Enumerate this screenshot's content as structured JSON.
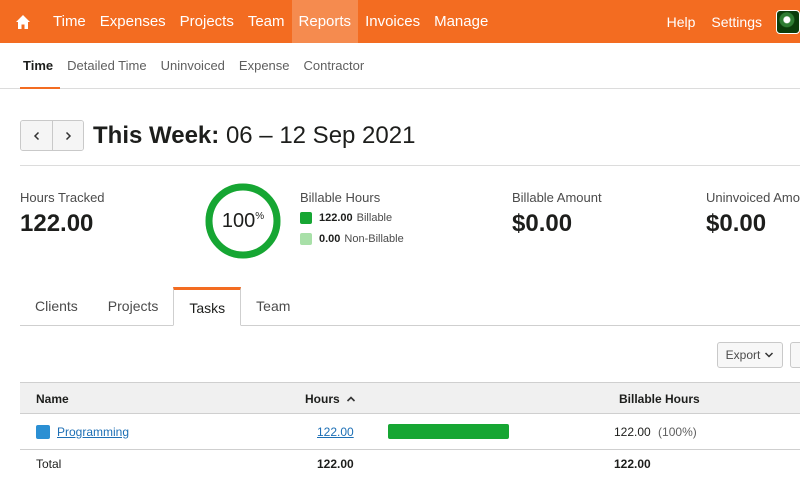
{
  "topnav": {
    "items": [
      {
        "label": "Time"
      },
      {
        "label": "Expenses"
      },
      {
        "label": "Projects"
      },
      {
        "label": "Team"
      },
      {
        "label": "Reports"
      },
      {
        "label": "Invoices"
      },
      {
        "label": "Manage"
      }
    ],
    "active": "Reports",
    "right": [
      {
        "label": "Help"
      },
      {
        "label": "Settings"
      }
    ]
  },
  "subnav": {
    "items": [
      {
        "label": "Time"
      },
      {
        "label": "Detailed Time"
      },
      {
        "label": "Uninvoiced"
      },
      {
        "label": "Expense"
      },
      {
        "label": "Contractor"
      }
    ],
    "active": "Time"
  },
  "period": {
    "bold": "This Week:",
    "range": "06 – 12 Sep 2021"
  },
  "summary": {
    "hours_tracked": {
      "label": "Hours Tracked",
      "value": "122.00"
    },
    "billable_percent": {
      "value": "100",
      "unit": "%",
      "fraction": 1.0
    },
    "billable_hours": {
      "label": "Billable Hours",
      "billable": {
        "value": "122.00",
        "label": "Billable"
      },
      "non_billable": {
        "value": "0.00",
        "label": "Non-Billable"
      }
    },
    "billable_amount": {
      "label": "Billable Amount",
      "value": "$0.00"
    },
    "uninvoiced_amount": {
      "label": "Uninvoiced Amo",
      "value": "$0.00"
    }
  },
  "tabs": [
    {
      "label": "Clients"
    },
    {
      "label": "Projects"
    },
    {
      "label": "Tasks"
    },
    {
      "label": "Team"
    }
  ],
  "active_tab": "Tasks",
  "export_label": "Export",
  "table": {
    "headers": {
      "name": "Name",
      "hours": "Hours",
      "billable_hours": "Billable Hours"
    },
    "rows": [
      {
        "name": "Programming",
        "hours": "122.00",
        "billable_hours": "122.00",
        "billable_percent": "(100%)",
        "bar_fraction": 1.0
      }
    ],
    "total": {
      "label": "Total",
      "hours": "122.00",
      "billable_hours": "122.00"
    }
  },
  "colors": {
    "brand": "#f36c21",
    "billable": "#16a633",
    "non_billable": "#a8e0a8",
    "task": "#2b8fd3"
  }
}
